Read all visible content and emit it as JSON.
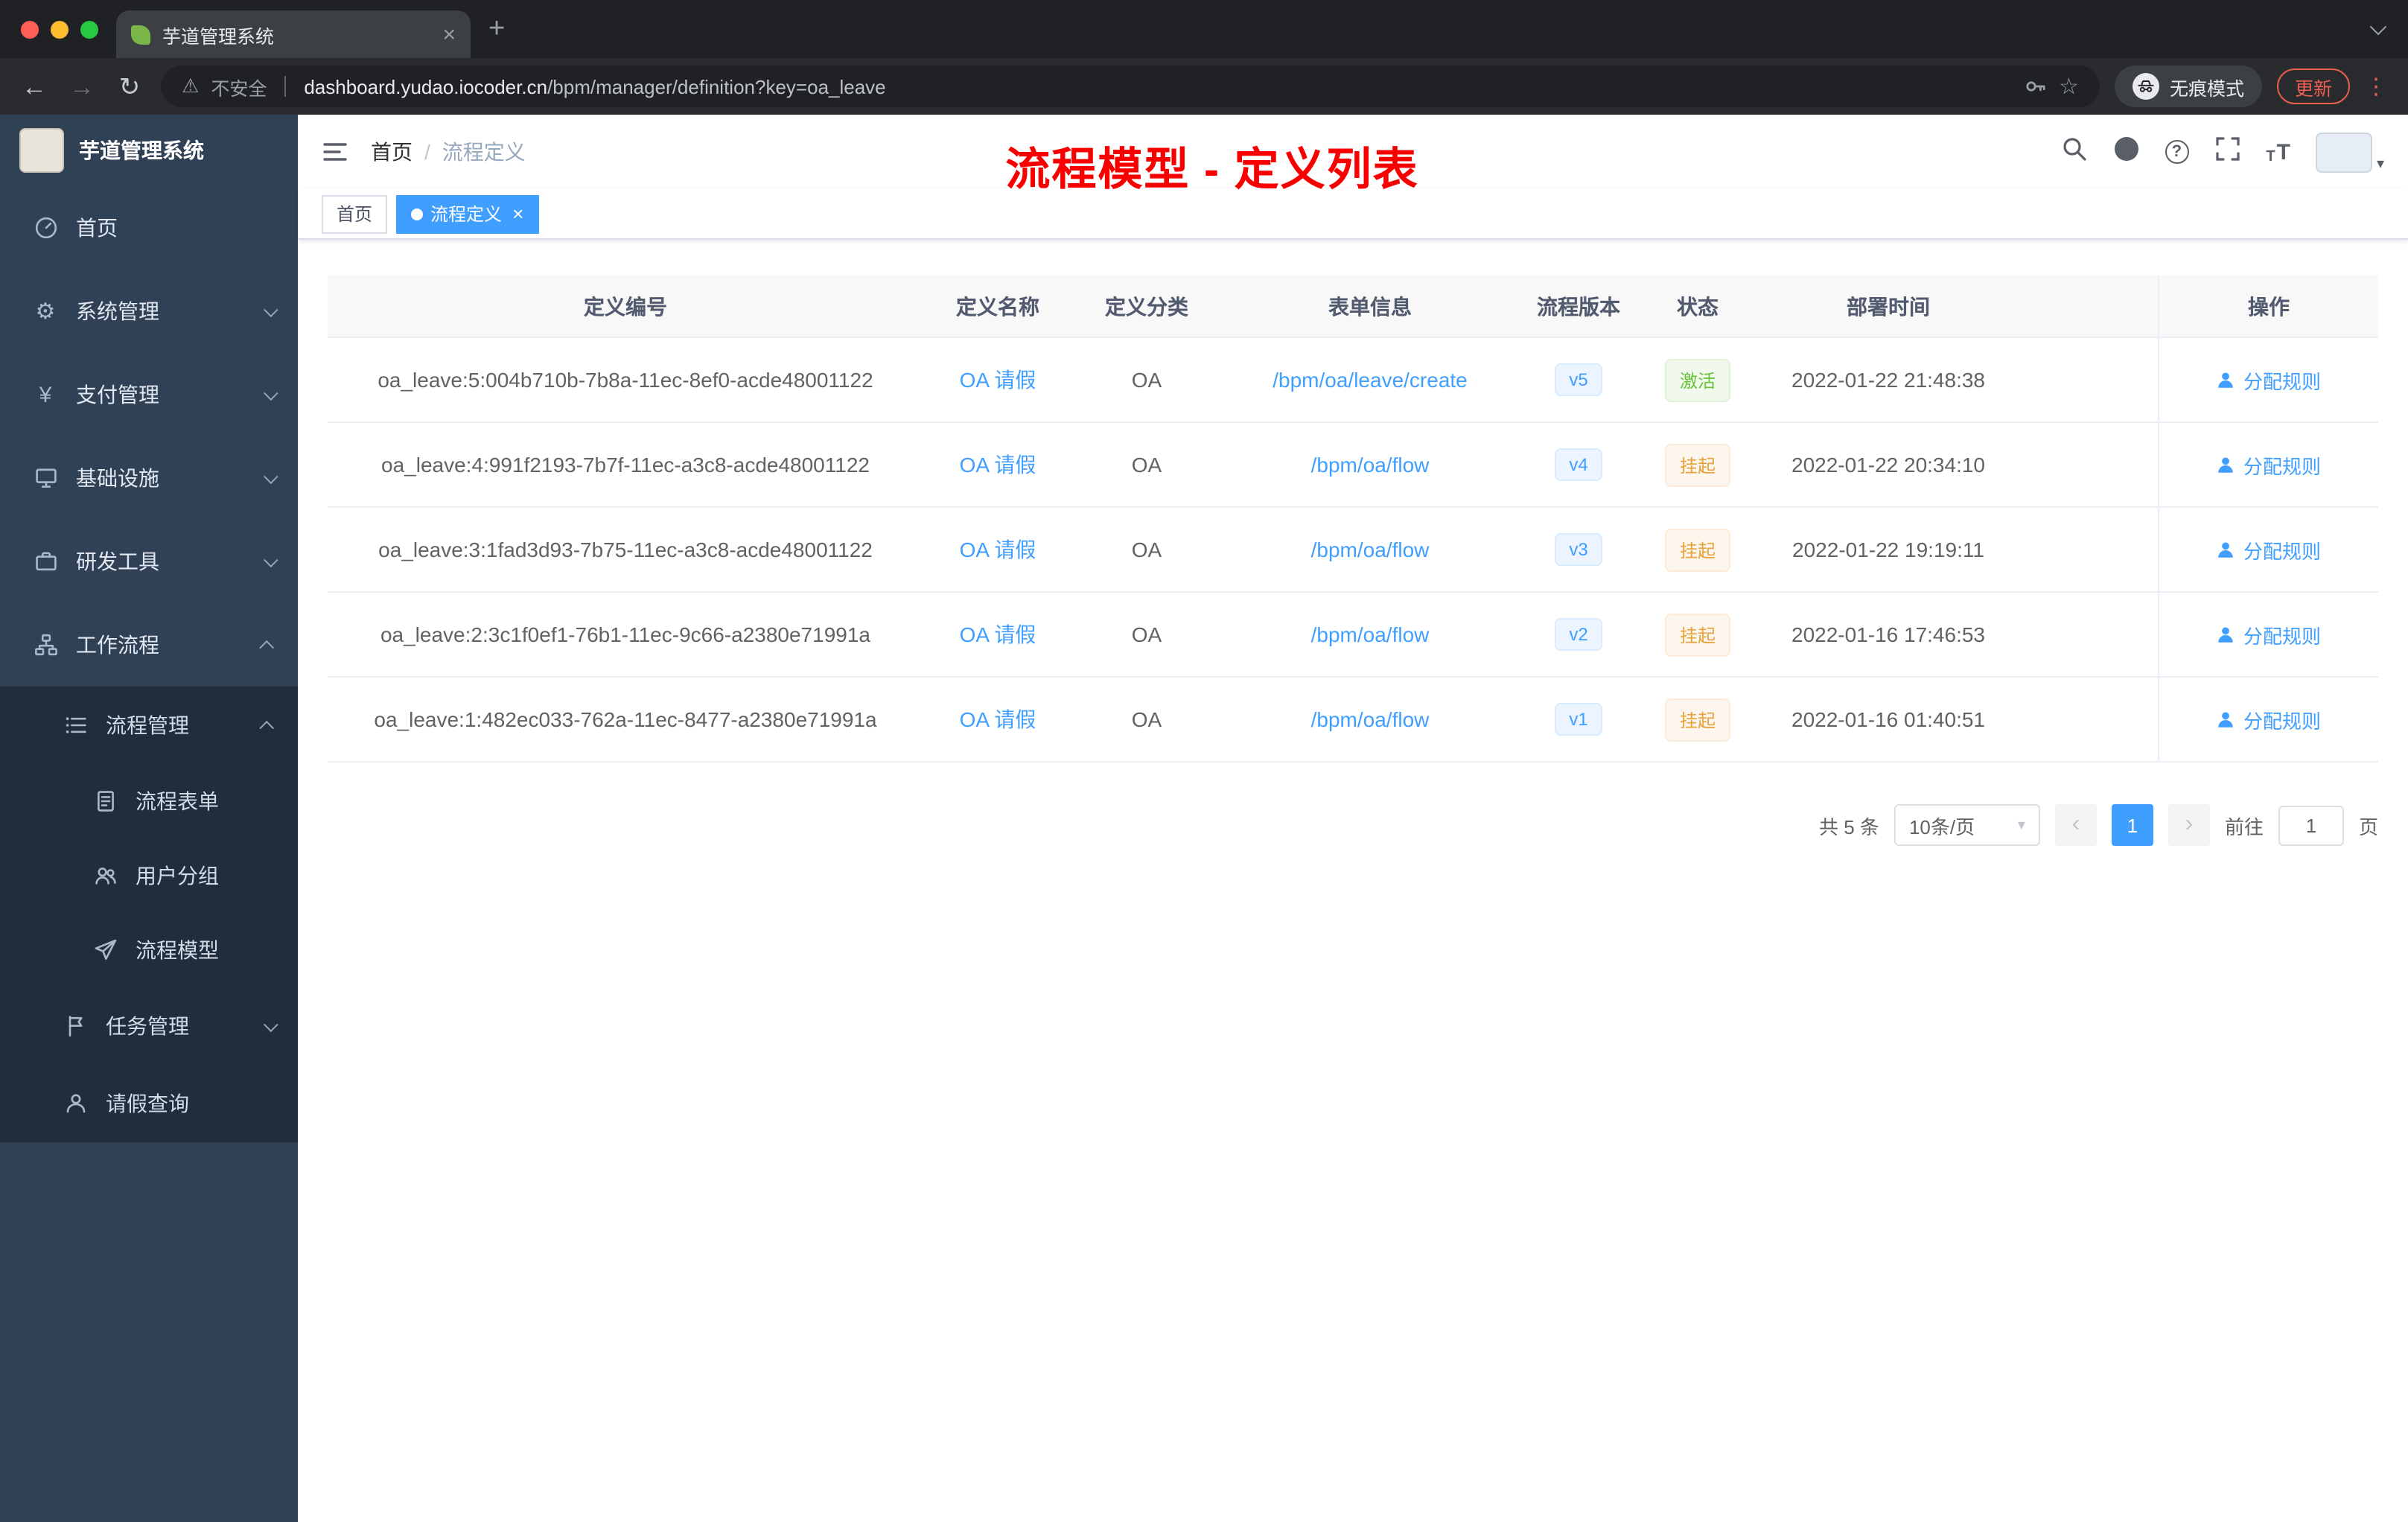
{
  "icons": {
    "close": "×",
    "new_tab": "+",
    "back": "←",
    "forward": "→",
    "reload": "↻",
    "warning": "⚠",
    "star": "☆",
    "more_vertical": "⋮",
    "gear": "⚙",
    "yen": "¥",
    "question": "?",
    "font_letter": "T",
    "caret_down": "▾",
    "prev": "‹",
    "next": "›"
  },
  "browser": {
    "tab_title": "芋道管理系统",
    "security_label": "不安全",
    "url_domain": "dashboard.yudao.iocoder.cn",
    "url_path": "/bpm/manager/definition?key=oa_leave",
    "incognito_label": "无痕模式",
    "update_label": "更新"
  },
  "sidebar": {
    "logo_title": "芋道管理系统",
    "items": [
      {
        "label": "首页"
      },
      {
        "label": "系统管理"
      },
      {
        "label": "支付管理"
      },
      {
        "label": "基础设施"
      },
      {
        "label": "研发工具"
      },
      {
        "label": "工作流程"
      }
    ],
    "workflow_submenu": {
      "process_group": {
        "label": "流程管理",
        "children": [
          {
            "label": "流程表单"
          },
          {
            "label": "用户分组"
          },
          {
            "label": "流程模型"
          }
        ]
      },
      "task_group": {
        "label": "任务管理"
      },
      "leave_query": {
        "label": "请假查询"
      }
    }
  },
  "navbar": {
    "breadcrumb_home": "首页",
    "breadcrumb_separator": "/",
    "breadcrumb_current": "流程定义"
  },
  "annotation": {
    "text": "流程模型 - 定义列表"
  },
  "tags": {
    "home": "首页",
    "active": "流程定义"
  },
  "table": {
    "columns": [
      "定义编号",
      "定义名称",
      "定义分类",
      "表单信息",
      "流程版本",
      "状态",
      "部署时间",
      "操作"
    ],
    "rows": [
      {
        "id": "oa_leave:5:004b710b-7b8a-11ec-8ef0-acde48001122",
        "name": "OA 请假",
        "category": "OA",
        "form": "/bpm/oa/leave/create",
        "version": "v5",
        "status": "激活",
        "status_class": "status-badge success",
        "deploy_time": "2022-01-22 21:48:38",
        "action": "分配规则"
      },
      {
        "id": "oa_leave:4:991f2193-7b7f-11ec-a3c8-acde48001122",
        "name": "OA 请假",
        "category": "OA",
        "form": "/bpm/oa/flow",
        "version": "v4",
        "status": "挂起",
        "status_class": "status-badge warning",
        "deploy_time": "2022-01-22 20:34:10",
        "action": "分配规则"
      },
      {
        "id": "oa_leave:3:1fad3d93-7b75-11ec-a3c8-acde48001122",
        "name": "OA 请假",
        "category": "OA",
        "form": "/bpm/oa/flow",
        "version": "v3",
        "status": "挂起",
        "status_class": "status-badge warning",
        "deploy_time": "2022-01-22 19:19:11",
        "action": "分配规则"
      },
      {
        "id": "oa_leave:2:3c1f0ef1-76b1-11ec-9c66-a2380e71991a",
        "name": "OA 请假",
        "category": "OA",
        "form": "/bpm/oa/flow",
        "version": "v2",
        "status": "挂起",
        "status_class": "status-badge warning",
        "deploy_time": "2022-01-16 17:46:53",
        "action": "分配规则"
      },
      {
        "id": "oa_leave:1:482ec033-762a-11ec-8477-a2380e71991a",
        "name": "OA 请假",
        "category": "OA",
        "form": "/bpm/oa/flow",
        "version": "v1",
        "status": "挂起",
        "status_class": "status-badge warning",
        "deploy_time": "2022-01-16 01:40:51",
        "action": "分配规则"
      }
    ]
  },
  "pagination": {
    "total_label": "共 5 条",
    "page_size_label": "10条/页",
    "current_page": "1",
    "goto_label": "前往",
    "goto_value": "1",
    "unit_label": "页"
  },
  "colors": {
    "primary": "#409eff",
    "success": "#67c23a",
    "warning": "#e6a23c",
    "annotation_red": "#ff0000",
    "sidebar_bg": "#304156",
    "submenu_bg": "#1f2d3d"
  }
}
